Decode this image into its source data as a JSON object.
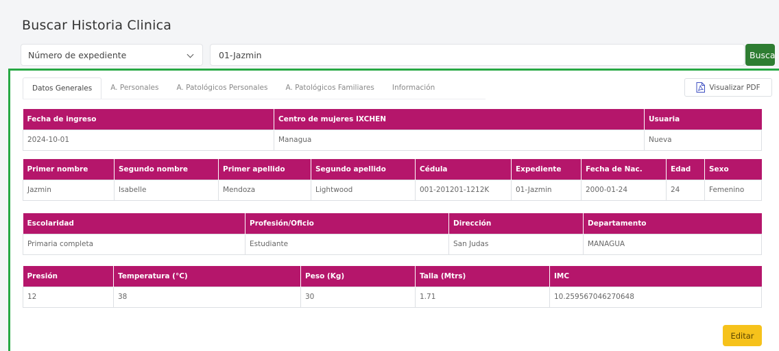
{
  "header": {
    "title": "Buscar Historia Clinica"
  },
  "search": {
    "select_value": "Número de expediente",
    "input_value": "01-Jazmin",
    "button_label": "Buscar"
  },
  "tabs": [
    {
      "label": "Datos Generales",
      "active": true
    },
    {
      "label": "A. Personales"
    },
    {
      "label": "A. Patológicos Personales"
    },
    {
      "label": "A. Patológicos Familiares"
    },
    {
      "label": "Información"
    }
  ],
  "pdf_button": {
    "label": "Visualizar PDF",
    "icon": "pdf-icon"
  },
  "table1": {
    "headers": [
      "Fecha de ingreso",
      "Centro de mujeres IXCHEN",
      "Usuaria"
    ],
    "row": [
      "2024-10-01",
      "Managua",
      "Nueva"
    ]
  },
  "table2": {
    "headers": [
      "Primer nombre",
      "Segundo nombre",
      "Primer apellido",
      "Segundo apellido",
      "Cédula",
      "Expediente",
      "Fecha de Nac.",
      "Edad",
      "Sexo"
    ],
    "row": [
      "Jazmin",
      "Isabelle",
      "Mendoza",
      "Lightwood",
      "001-201201-1212K",
      "01-Jazmin",
      "2000-01-24",
      "24",
      "Femenino"
    ]
  },
  "table3": {
    "headers": [
      "Escolaridad",
      "Profesión/Oficio",
      "Dirección",
      "Departamento"
    ],
    "row": [
      "Primaria completa",
      "Estudiante",
      "San Judas",
      "MANAGUA"
    ]
  },
  "table4": {
    "headers": [
      "Presión",
      "Temperatura (°C)",
      "Peso (Kg)",
      "Talla (Mtrs)",
      "IMC"
    ],
    "row": [
      "12",
      "38",
      "30",
      "1.71",
      "10.259567046270648"
    ]
  },
  "edit_button": {
    "label": "Editar"
  },
  "colors": {
    "header_bg": "#b5166b",
    "accent_green": "#27a844",
    "buscar_bg": "#2e7d32",
    "editar_bg": "#f6c21b"
  }
}
